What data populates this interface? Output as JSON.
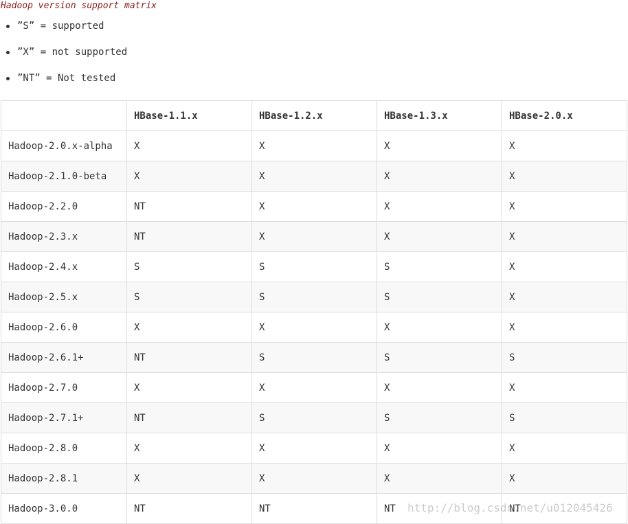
{
  "caption": "Hadoop version support matrix",
  "legend": [
    {
      "text": "”S” = supported"
    },
    {
      "text": "”X” = not supported"
    },
    {
      "text": "”NT” = Not tested"
    }
  ],
  "table": {
    "columns": [
      "",
      "HBase-1.1.x",
      "HBase-1.2.x",
      "HBase-1.3.x",
      "HBase-2.0.x"
    ],
    "rows": [
      [
        "Hadoop-2.0.x-alpha",
        "X",
        "X",
        "X",
        "X"
      ],
      [
        "Hadoop-2.1.0-beta",
        "X",
        "X",
        "X",
        "X"
      ],
      [
        "Hadoop-2.2.0",
        "NT",
        "X",
        "X",
        "X"
      ],
      [
        "Hadoop-2.3.x",
        "NT",
        "X",
        "X",
        "X"
      ],
      [
        "Hadoop-2.4.x",
        "S",
        "S",
        "S",
        "X"
      ],
      [
        "Hadoop-2.5.x",
        "S",
        "S",
        "S",
        "X"
      ],
      [
        "Hadoop-2.6.0",
        "X",
        "X",
        "X",
        "X"
      ],
      [
        "Hadoop-2.6.1+",
        "NT",
        "S",
        "S",
        "S"
      ],
      [
        "Hadoop-2.7.0",
        "X",
        "X",
        "X",
        "X"
      ],
      [
        "Hadoop-2.7.1+",
        "NT",
        "S",
        "S",
        "S"
      ],
      [
        "Hadoop-2.8.0",
        "X",
        "X",
        "X",
        "X"
      ],
      [
        "Hadoop-2.8.1",
        "X",
        "X",
        "X",
        "X"
      ],
      [
        "Hadoop-3.0.0",
        "NT",
        "NT",
        "NT",
        "NT"
      ]
    ]
  },
  "watermark": "http://blog.csdn.net/u012045426"
}
